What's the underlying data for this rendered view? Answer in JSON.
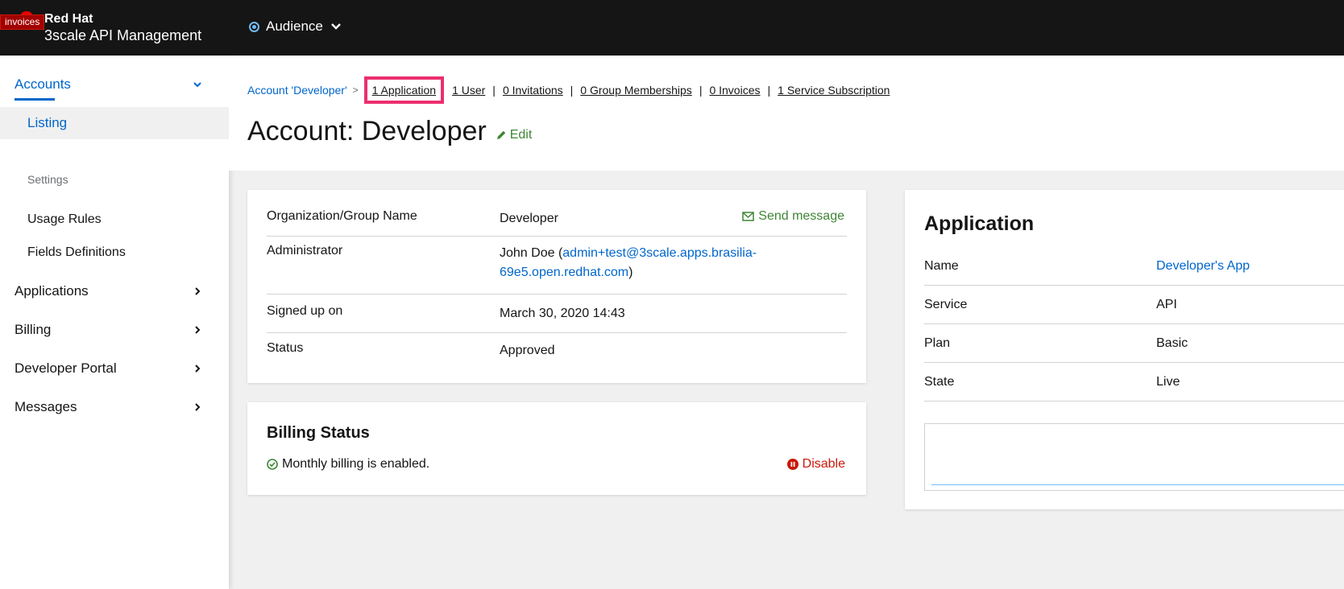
{
  "header": {
    "brand_line1": "Red Hat",
    "brand_line2": "3scale API Management",
    "invoices_tag": "invoices",
    "context_label": "Audience"
  },
  "sidebar": {
    "accounts": "Accounts",
    "listing": "Listing",
    "settings_heading": "Settings",
    "usage_rules": "Usage Rules",
    "fields_definitions": "Fields Definitions",
    "applications": "Applications",
    "billing": "Billing",
    "developer_portal": "Developer Portal",
    "messages": "Messages"
  },
  "breadcrumbs": {
    "root": "Account 'Developer'",
    "links": [
      "1 Application",
      "1 User",
      "0 Invitations",
      "0 Group Memberships",
      "0 Invoices",
      "1 Service Subscription"
    ]
  },
  "page": {
    "title": "Account: Developer",
    "edit": "Edit"
  },
  "details": {
    "org_label": "Organization/Group Name",
    "org_value": "Developer",
    "send_message": "Send message",
    "admin_label": "Administrator",
    "admin_name_prefix": "John Doe (",
    "admin_email": "admin+test@3scale.apps.brasilia-69e5.open.redhat.com",
    "admin_name_suffix": ")",
    "signed_label": "Signed up on",
    "signed_value": "March 30, 2020 14:43",
    "status_label": "Status",
    "status_value": "Approved"
  },
  "billing": {
    "title": "Billing Status",
    "status": "Monthly billing is enabled.",
    "disable": "Disable"
  },
  "application": {
    "title": "Application",
    "rows": [
      {
        "label": "Name",
        "value": "Developer's App"
      },
      {
        "label": "Service",
        "value": "API"
      },
      {
        "label": "Plan",
        "value": "Basic"
      },
      {
        "label": "State",
        "value": "Live"
      }
    ]
  },
  "colors": {
    "accent": "#0066cc",
    "success": "#3e8635",
    "danger": "#c9190b",
    "highlight": "#ec2f6e"
  }
}
